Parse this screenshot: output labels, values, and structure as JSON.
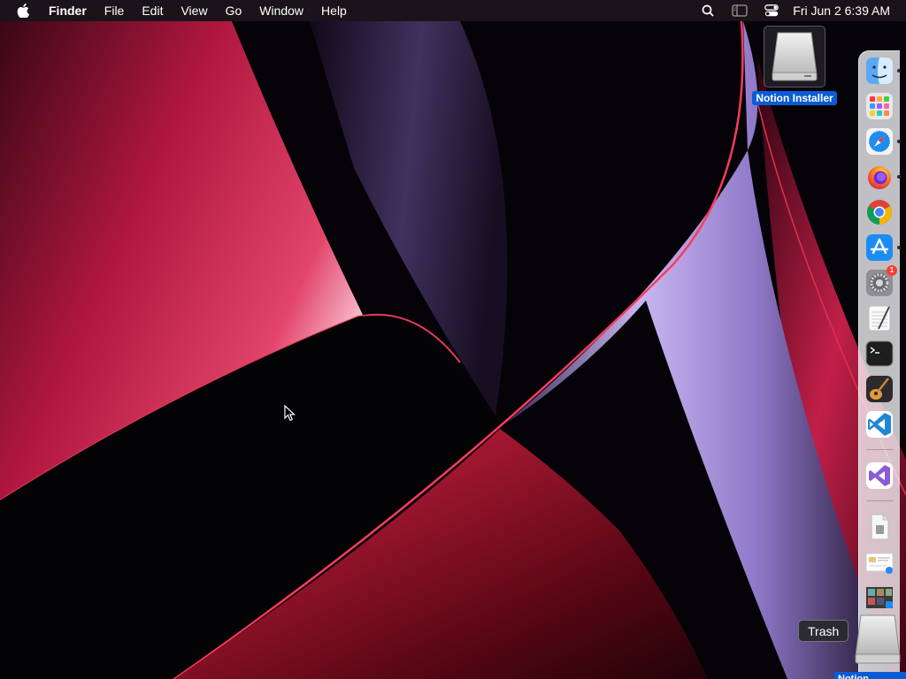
{
  "menubar": {
    "app_name": "Finder",
    "items": [
      "File",
      "Edit",
      "View",
      "Go",
      "Window",
      "Help"
    ],
    "status_icons": [
      "search-icon",
      "sidebar-icon",
      "control-center-icon"
    ],
    "clock": "Fri Jun 2  6:39 AM"
  },
  "desktop": {
    "drive_label": "Notion Installer",
    "partial_label": "Notion Installer"
  },
  "dock": {
    "items": [
      {
        "name": "finder",
        "icon": "finder-icon",
        "running": true
      },
      {
        "name": "launchpad",
        "icon": "launchpad-icon",
        "running": false
      },
      {
        "name": "safari",
        "icon": "safari-icon",
        "running": true
      },
      {
        "name": "firefox",
        "icon": "firefox-icon",
        "running": true
      },
      {
        "name": "chrome",
        "icon": "chrome-icon",
        "running": false
      },
      {
        "name": "app-store",
        "icon": "app-store-icon",
        "running": true
      },
      {
        "name": "system-settings",
        "icon": "gear-icon",
        "badge": "1",
        "running": false
      },
      {
        "name": "textedit",
        "icon": "textedit-icon",
        "running": false
      },
      {
        "name": "terminal",
        "icon": "terminal-icon",
        "running": false
      },
      {
        "name": "garageband",
        "icon": "guitar-icon",
        "running": false
      },
      {
        "name": "vscode",
        "icon": "vscode-icon",
        "running": false
      },
      {
        "name": "visual-studio",
        "icon": "visual-studio-icon",
        "running": false
      },
      {
        "name": "document",
        "icon": "document-icon",
        "running": false
      },
      {
        "name": "downloads-stack",
        "icon": "stack-icon",
        "running": false
      },
      {
        "name": "applications-stack",
        "icon": "stack-icon",
        "running": false
      },
      {
        "name": "trash",
        "icon": "trash-icon",
        "running": false
      }
    ],
    "tooltip": "Trash"
  },
  "colors": {
    "menubar_bg": "#1c161c",
    "selection_blue": "#0a5bd6",
    "dock_bg": "#f5f5f8"
  }
}
